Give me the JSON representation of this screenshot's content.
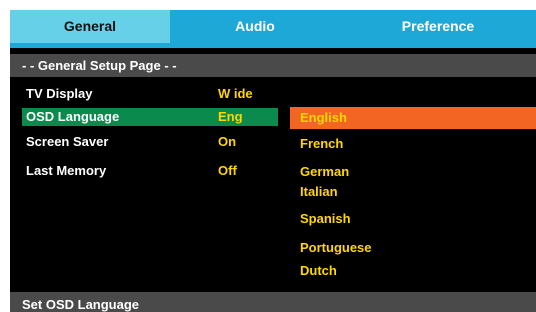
{
  "tabs": [
    {
      "label": "General"
    },
    {
      "label": "Audio"
    },
    {
      "label": "Preference"
    }
  ],
  "page_header": "- -  General Setup Page - -",
  "settings": [
    {
      "label": "TV Display",
      "value": "W ide"
    },
    {
      "label": "OSD Language",
      "value": "Eng"
    },
    {
      "label": "Screen Saver",
      "value": "On"
    },
    {
      "label": "Last Memory",
      "value": "Off"
    }
  ],
  "options": [
    "English",
    "French",
    "German",
    "Italian",
    "Spanish",
    "Portuguese",
    "Dutch"
  ],
  "footer_hint": "Set OSD Language",
  "colors": {
    "tab_active": "#66d0e8",
    "tab_inactive": "#1da8d8",
    "selected_row": "#0a8a4c",
    "selected_option": "#f26522",
    "value_text": "#ffd700",
    "header_bar": "#4a4a4a"
  }
}
